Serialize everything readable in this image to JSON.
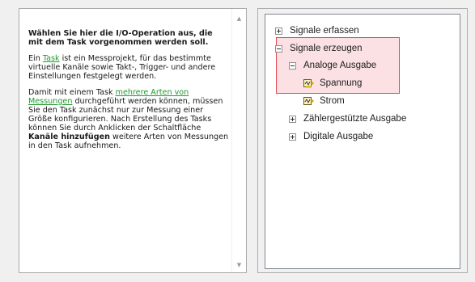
{
  "help": {
    "heading": "Wählen Sie hier die I/O-Operation aus, die mit dem Task vorgenommen werden soll.",
    "p1_prefix": "Ein ",
    "p1_link": "Task",
    "p1_suffix": " ist ein Messprojekt, für das bestimmte virtuelle Kanäle sowie Takt-, Trigger- und andere Einstellungen festgelegt werden.",
    "p2_prefix": "Damit mit einem Task ",
    "p2_link": "mehrere Arten von Messungen",
    "p2_mid": " durchgeführt werden können, müssen Sie den Task zunächst nur zur Messung einer Größe konfigurieren. Nach Erstellung des Tasks können Sie durch Anklicken der Schaltfläche ",
    "p2_bold": "Kanäle hinzufügen",
    "p2_suffix": " weitere Arten von Messungen in den Task aufnehmen.",
    "link_color": "#1f9a2f"
  },
  "tree": {
    "items": [
      {
        "label": "Signale erfassen",
        "expander": "plus",
        "icon": null
      },
      {
        "label": "Signale erzeugen",
        "expander": "minus",
        "icon": null
      },
      {
        "label": "Analoge Ausgabe",
        "expander": "minus",
        "icon": null
      },
      {
        "label": "Spannung",
        "expander": null,
        "icon": "analog-output-voltage-icon"
      },
      {
        "label": "Strom",
        "expander": null,
        "icon": "analog-output-current-icon"
      },
      {
        "label": "Zählergestützte Ausgabe",
        "expander": "plus",
        "icon": null
      },
      {
        "label": "Digitale Ausgabe",
        "expander": "plus",
        "icon": null
      }
    ],
    "highlight_color": "#e8434a"
  }
}
